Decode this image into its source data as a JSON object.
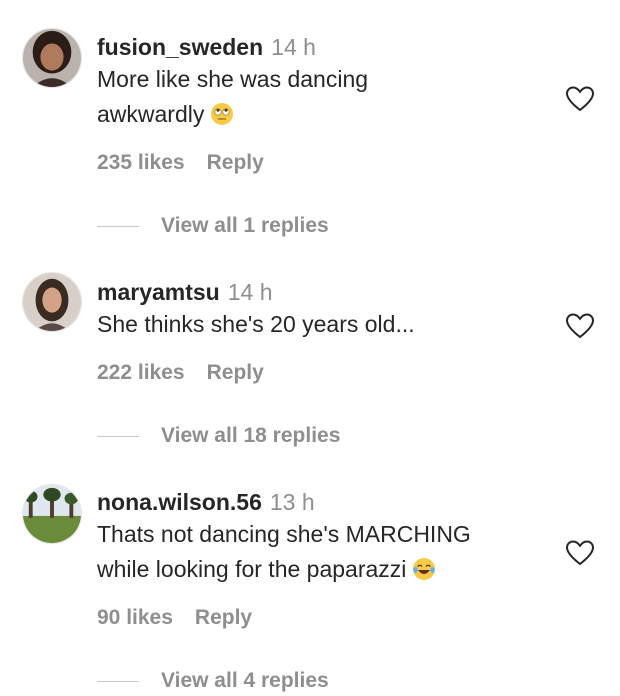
{
  "comments": [
    {
      "username": "fusion_sweden",
      "time": "14 h",
      "text_line1": "More like she was dancing",
      "text_line2": "awkwardly",
      "emoji": "eye-roll-emoji",
      "likes": "235 likes",
      "reply": "Reply",
      "view_replies": "View all 1 replies",
      "avatar": "woman-avatar-1"
    },
    {
      "username": "maryamtsu",
      "time": "14 h",
      "text_line1": "She thinks she's 20 years old...",
      "likes": "222 likes",
      "reply": "Reply",
      "view_replies": "View all 18 replies",
      "avatar": "woman-avatar-2"
    },
    {
      "username": "nona.wilson.56",
      "time": "13 h",
      "text_line1": "Thats not dancing she's MARCHING",
      "text_line2": "while looking for the paparazzi",
      "emoji": "laughing-tears-emoji",
      "likes": "90 likes",
      "reply": "Reply",
      "view_replies": "View all 4 replies",
      "avatar": "landscape-avatar"
    }
  ],
  "icons": {
    "like": "heart-outline-icon"
  },
  "colors": {
    "text": "#262626",
    "secondary": "#8e8e8e"
  }
}
